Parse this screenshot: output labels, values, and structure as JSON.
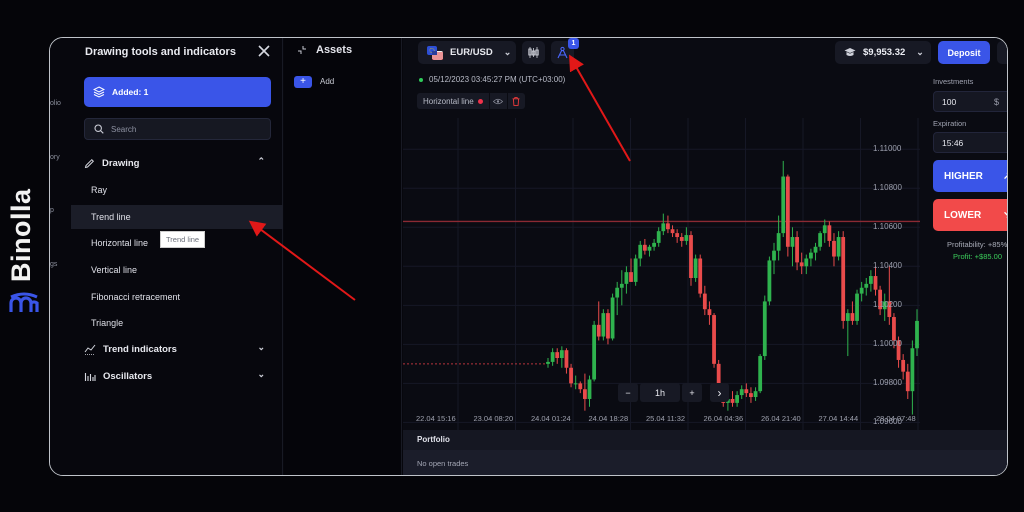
{
  "brand": {
    "name": "Binolla",
    "logo_color": "#3a55e8"
  },
  "navstrip": {
    "partial_labels": [
      "olio",
      "ory",
      "p",
      "gs"
    ]
  },
  "drawer": {
    "title": "Drawing tools and indicators",
    "added_label": "Added: 1",
    "search_placeholder": "Search",
    "sections": [
      {
        "label": "Drawing",
        "icon": "pencil-icon",
        "expanded": true,
        "items": [
          "Ray",
          "Trend line",
          "Horizontal line",
          "Vertical line",
          "Fibonacci retracement",
          "Triangle"
        ]
      },
      {
        "label": "Trend indicators",
        "icon": "trend-indicators-icon",
        "expanded": false
      },
      {
        "label": "Oscillators",
        "icon": "oscillators-icon",
        "expanded": false
      }
    ],
    "active_item": "Trend line",
    "tooltip": "Trend line"
  },
  "assets": {
    "title": "Assets",
    "add_label": "Add",
    "add_symbol": "+"
  },
  "topbar": {
    "pair": "EUR/USD",
    "drawing_badge": "1",
    "balance": "$9,953.32",
    "deposit_label": "Deposit"
  },
  "chart_header": {
    "datetime": "05/12/2023  03:45:27 PM  (UTC+03:00)",
    "drawing_tag": "Horizontal line"
  },
  "chart_data": {
    "type": "candlestick",
    "symbol": "EUR/USD",
    "timeframe": "1h",
    "y_ticks": [
      "1.11000",
      "1.10800",
      "1.10600",
      "1.10400",
      "1.10200",
      "1.10000",
      "1.09800",
      "1.09600"
    ],
    "ylim": [
      1.0952,
      1.1116
    ],
    "x_ticks": [
      "22.04 15:16",
      "23.04 08:20",
      "24.04 01:24",
      "24.04 18:28",
      "25.04 11:32",
      "26.04 04:36",
      "26.04 21:40",
      "27.04 14:44",
      "28.04 07:48"
    ],
    "horizontal_line": 1.1063,
    "dotted_line": 1.099,
    "colors": {
      "up": "#2fb34e",
      "down": "#e94b4b",
      "hline": "#8b2a33"
    },
    "candles": [
      [
        1.099,
        1.0993,
        1.0988,
        1.0991
      ],
      [
        1.0991,
        1.0998,
        1.0989,
        1.0996
      ],
      [
        1.0996,
        1.0998,
        1.099,
        1.0993
      ],
      [
        1.0993,
        1.0999,
        1.0988,
        1.0997
      ],
      [
        1.0997,
        1.0998,
        1.0985,
        1.0988
      ],
      [
        1.0988,
        1.099,
        1.0978,
        1.098
      ],
      [
        1.098,
        1.0984,
        1.0977,
        1.098
      ],
      [
        1.098,
        1.0981,
        1.0975,
        1.0977
      ],
      [
        1.0977,
        1.0985,
        1.0966,
        1.0972
      ],
      [
        1.0972,
        1.0984,
        1.0968,
        1.0982
      ],
      [
        1.0982,
        1.1012,
        1.0981,
        1.101
      ],
      [
        1.101,
        1.1022,
        1.1002,
        1.1004
      ],
      [
        1.1004,
        1.1018,
        1.1002,
        1.1016
      ],
      [
        1.1016,
        1.1018,
        1.1,
        1.1003
      ],
      [
        1.1003,
        1.1026,
        1.1002,
        1.1024
      ],
      [
        1.1024,
        1.1032,
        1.1015,
        1.1029
      ],
      [
        1.1029,
        1.1038,
        1.102,
        1.1031
      ],
      [
        1.1031,
        1.104,
        1.1026,
        1.1037
      ],
      [
        1.1037,
        1.1044,
        1.1032,
        1.1032
      ],
      [
        1.1032,
        1.1046,
        1.103,
        1.1044
      ],
      [
        1.1044,
        1.1053,
        1.104,
        1.1051
      ],
      [
        1.1051,
        1.1054,
        1.1046,
        1.1048
      ],
      [
        1.1048,
        1.1051,
        1.1045,
        1.105
      ],
      [
        1.105,
        1.1054,
        1.1048,
        1.1052
      ],
      [
        1.1052,
        1.106,
        1.105,
        1.1058
      ],
      [
        1.1058,
        1.1067,
        1.1056,
        1.1062
      ],
      [
        1.1062,
        1.1066,
        1.1057,
        1.1059
      ],
      [
        1.1059,
        1.1061,
        1.1055,
        1.1057
      ],
      [
        1.1057,
        1.1059,
        1.1052,
        1.1055
      ],
      [
        1.1055,
        1.1057,
        1.105,
        1.1053
      ],
      [
        1.1053,
        1.106,
        1.1051,
        1.1056
      ],
      [
        1.1056,
        1.1058,
        1.103,
        1.1034
      ],
      [
        1.1034,
        1.1046,
        1.1032,
        1.1044
      ],
      [
        1.1044,
        1.1046,
        1.1024,
        1.1026
      ],
      [
        1.1026,
        1.103,
        1.1015,
        1.1018
      ],
      [
        1.1018,
        1.1022,
        1.101,
        1.1015
      ],
      [
        1.1015,
        1.1016,
        1.0988,
        1.099
      ],
      [
        1.099,
        1.0992,
        1.0972,
        1.0976
      ],
      [
        1.0976,
        1.0978,
        1.0968,
        1.097
      ],
      [
        1.097,
        1.0974,
        1.0966,
        1.0972
      ],
      [
        1.0972,
        1.0976,
        1.0968,
        1.097
      ],
      [
        1.097,
        1.0976,
        1.0968,
        1.0974
      ],
      [
        1.0974,
        1.0979,
        1.0972,
        1.0977
      ],
      [
        1.0977,
        1.098,
        1.0973,
        1.0975
      ],
      [
        1.0975,
        1.0978,
        1.097,
        1.0973
      ],
      [
        1.0973,
        1.0978,
        1.0971,
        1.0976
      ],
      [
        1.0976,
        1.0995,
        1.0975,
        1.0994
      ],
      [
        1.0994,
        1.1025,
        1.0992,
        1.1022
      ],
      [
        1.1022,
        1.1045,
        1.102,
        1.1043
      ],
      [
        1.1043,
        1.1052,
        1.1036,
        1.1048
      ],
      [
        1.1048,
        1.1066,
        1.1043,
        1.1057
      ],
      [
        1.1057,
        1.1094,
        1.1055,
        1.1086
      ],
      [
        1.1086,
        1.1087,
        1.1045,
        1.105
      ],
      [
        1.105,
        1.106,
        1.104,
        1.1055
      ],
      [
        1.1055,
        1.1058,
        1.1038,
        1.1042
      ],
      [
        1.1042,
        1.1047,
        1.1036,
        1.104
      ],
      [
        1.104,
        1.1046,
        1.1036,
        1.1044
      ],
      [
        1.1044,
        1.1049,
        1.104,
        1.1047
      ],
      [
        1.1047,
        1.1052,
        1.1043,
        1.105
      ],
      [
        1.105,
        1.1058,
        1.1048,
        1.1057
      ],
      [
        1.1057,
        1.1064,
        1.1052,
        1.1061
      ],
      [
        1.1061,
        1.1063,
        1.105,
        1.1053
      ],
      [
        1.1053,
        1.1057,
        1.104,
        1.1045
      ],
      [
        1.1045,
        1.1058,
        1.1043,
        1.1055
      ],
      [
        1.1055,
        1.1058,
        1.1008,
        1.1012
      ],
      [
        1.1012,
        1.1018,
        1.0994,
        1.1016
      ],
      [
        1.1016,
        1.1022,
        1.101,
        1.1012
      ],
      [
        1.1012,
        1.1028,
        1.101,
        1.1026
      ],
      [
        1.1026,
        1.1032,
        1.1022,
        1.1029
      ],
      [
        1.1029,
        1.1034,
        1.1025,
        1.1031
      ],
      [
        1.1031,
        1.1038,
        1.1027,
        1.1035
      ],
      [
        1.1035,
        1.104,
        1.1025,
        1.1028
      ],
      [
        1.1028,
        1.103,
        1.1015,
        1.1018
      ],
      [
        1.1018,
        1.1026,
        1.1012,
        1.1022
      ],
      [
        1.1022,
        1.104,
        1.101,
        1.1014
      ],
      [
        1.1014,
        1.1016,
        1.0998,
        1.1002
      ],
      [
        1.1002,
        1.1004,
        1.0988,
        1.0992
      ],
      [
        1.0992,
        1.0995,
        1.0982,
        1.0986
      ],
      [
        1.0986,
        1.099,
        1.0972,
        1.0976
      ],
      [
        1.0976,
        1.1002,
        1.0964,
        1.0998
      ],
      [
        1.0998,
        1.1018,
        1.0994,
        1.1012
      ]
    ]
  },
  "chart_controls": {
    "zoom_out": "−",
    "timeframe": "1h",
    "zoom_in": "+",
    "next": "›"
  },
  "portfolio": {
    "title": "Portfolio",
    "empty_text": "No open trades"
  },
  "trade_panel": {
    "investments_label": "Investments",
    "investment_value": "100",
    "currency_symbol": "$",
    "expiration_label": "Expiration",
    "expiration_value": "15:46",
    "higher_label": "HIGHER",
    "lower_label": "LOWER",
    "profitability": "Profitability: +85%",
    "profit": "Profit: +$85.00"
  }
}
